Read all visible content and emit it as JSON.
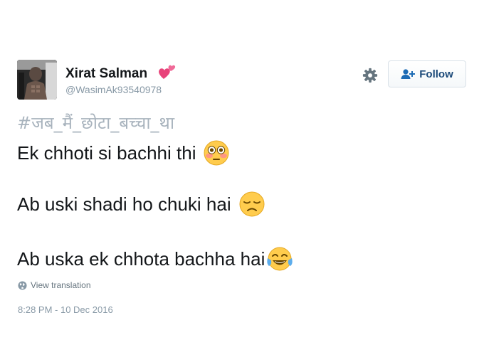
{
  "user": {
    "display_name": "Xirat Salman",
    "handle": "@WasimAk93540978",
    "name_emoji_icon": "two-hearts-icon"
  },
  "actions": {
    "settings_icon": "gear-icon",
    "follow_label": "Follow",
    "follow_icon": "add-user-icon"
  },
  "tweet": {
    "hashtag": "#जब_मैं_छोटा_बच्चा_था",
    "lines": [
      {
        "text": "Ek chhoti si bachhi thi",
        "emoji_icon": "flushed-face-icon"
      },
      {
        "text": "Ab uski shadi ho chuki hai",
        "emoji_icon": "disappointed-face-icon"
      },
      {
        "text": "Ab uska ek chhota bachha hai",
        "emoji_icon": "tears-of-joy-icon"
      }
    ],
    "view_translation": "View translation",
    "view_translation_icon": "globe-icon",
    "timestamp": "8:28 PM - 10 Dec 2016"
  },
  "colors": {
    "name": "#14171a",
    "secondary": "#8899a6",
    "hashtag": "#a8b3bd",
    "follow_text": "#1c4a7a",
    "emoji_yellow": "#ffcc4d"
  }
}
